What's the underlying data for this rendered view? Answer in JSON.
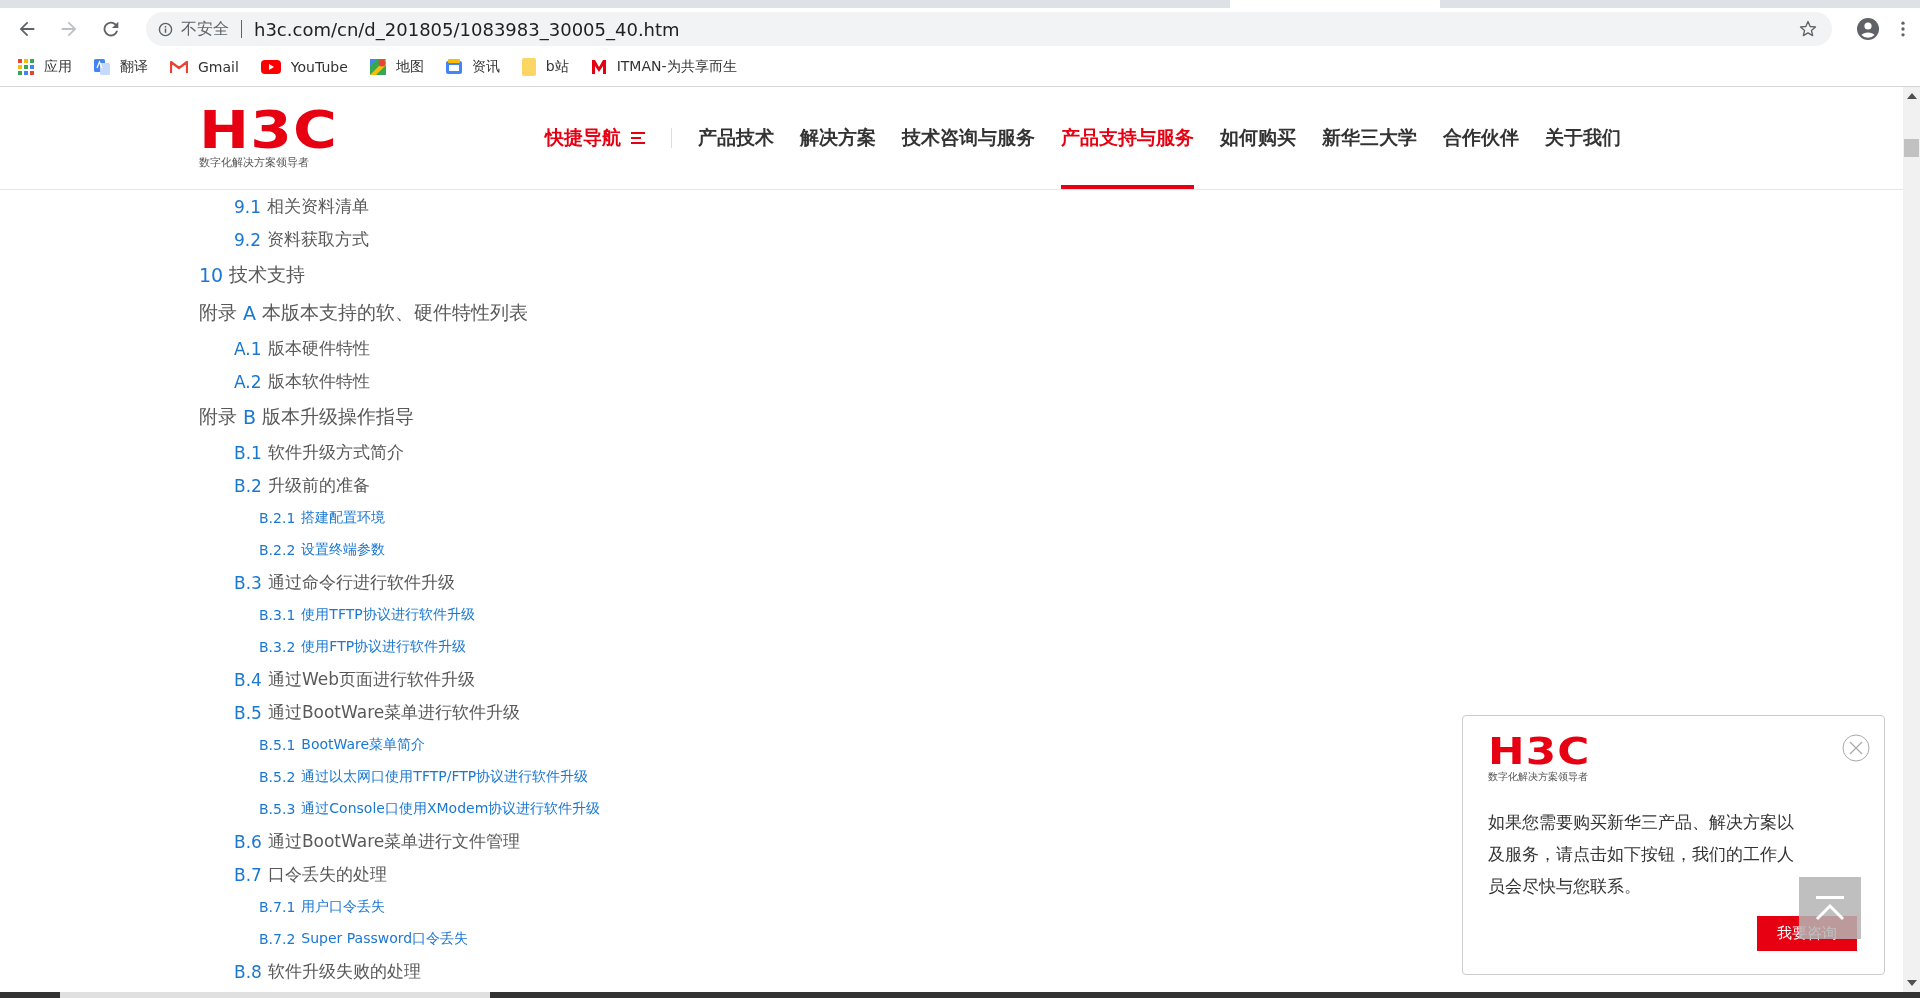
{
  "browser": {
    "security": "不安全",
    "url": "h3c.com/cn/d_201805/1083983_30005_40.htm",
    "bookmarks": [
      {
        "label": "应用",
        "kind": "apps"
      },
      {
        "label": "翻译",
        "kind": "translate"
      },
      {
        "label": "Gmail",
        "kind": "gmail"
      },
      {
        "label": "YouTube",
        "kind": "youtube"
      },
      {
        "label": "地图",
        "kind": "maps"
      },
      {
        "label": "资讯",
        "kind": "news"
      },
      {
        "label": "b站",
        "kind": "folder"
      },
      {
        "label": "ITMAN-为共享而生",
        "kind": "mlogo"
      }
    ]
  },
  "header": {
    "logo": "H3C",
    "tagline": "数字化解决方案领导者",
    "nav": [
      {
        "label": "快捷导航",
        "kind": "quick",
        "selected": false
      },
      {
        "label": "产品技术",
        "kind": "link",
        "selected": false
      },
      {
        "label": "解决方案",
        "kind": "link",
        "selected": false
      },
      {
        "label": "技术咨询与服务",
        "kind": "link",
        "selected": false
      },
      {
        "label": "产品支持与服务",
        "kind": "link",
        "selected": true
      },
      {
        "label": "如何购买",
        "kind": "link",
        "selected": false
      },
      {
        "label": "新华三大学",
        "kind": "link",
        "selected": false
      },
      {
        "label": "合作伙伴",
        "kind": "link",
        "selected": false
      },
      {
        "label": "关于我们",
        "kind": "link",
        "selected": false
      }
    ]
  },
  "toc": [
    {
      "children": [
        {
          "number": "9.1",
          "title": "相关资料清单"
        },
        {
          "number": "9.2",
          "title": "资料获取方式"
        }
      ]
    },
    {
      "number": "10",
      "title": "技术支持"
    },
    {
      "prefix": "附录",
      "number": "A",
      "title": "本版本支持的软、硬件特性列表",
      "children": [
        {
          "number": "A.1",
          "title": "版本硬件特性"
        },
        {
          "number": "A.2",
          "title": "版本软件特性"
        }
      ]
    },
    {
      "prefix": "附录",
      "number": "B",
      "title": "版本升级操作指导",
      "children": [
        {
          "number": "B.1",
          "title": "软件升级方式简介"
        },
        {
          "number": "B.2",
          "title": "升级前的准备",
          "children": [
            {
              "number": "B.2.1",
              "title": "搭建配置环境"
            },
            {
              "number": "B.2.2",
              "title": "设置终端参数"
            }
          ]
        },
        {
          "number": "B.3",
          "title": "通过命令行进行软件升级",
          "children": [
            {
              "number": "B.3.1",
              "title": "使用TFTP协议进行软件升级"
            },
            {
              "number": "B.3.2",
              "title": "使用FTP协议进行软件升级"
            }
          ]
        },
        {
          "number": "B.4",
          "title": "通过Web页面进行软件升级"
        },
        {
          "number": "B.5",
          "title": "通过BootWare菜单进行软件升级",
          "children": [
            {
              "number": "B.5.1",
              "title": "BootWare菜单简介"
            },
            {
              "number": "B.5.2",
              "title": "通过以太网口使用TFTP/FTP协议进行软件升级"
            },
            {
              "number": "B.5.3",
              "title": "通过Console口使用XModem协议进行软件升级"
            }
          ]
        },
        {
          "number": "B.6",
          "title": "通过BootWare菜单进行文件管理"
        },
        {
          "number": "B.7",
          "title": "口令丢失的处理",
          "children": [
            {
              "number": "B.7.1",
              "title": "用户口令丢失"
            },
            {
              "number": "B.7.2",
              "title": "Super Password口令丢失"
            }
          ]
        },
        {
          "number": "B.8",
          "title": "软件升级失败的处理"
        }
      ]
    }
  ],
  "popup": {
    "logo": "H3C",
    "tagline": "数字化解决方案领导者",
    "message": "如果您需要购买新华三产品、解决方案以及服务，请点击如下按钮，我们的工作人员会尽快与您联系。",
    "button": "我要咨询"
  }
}
